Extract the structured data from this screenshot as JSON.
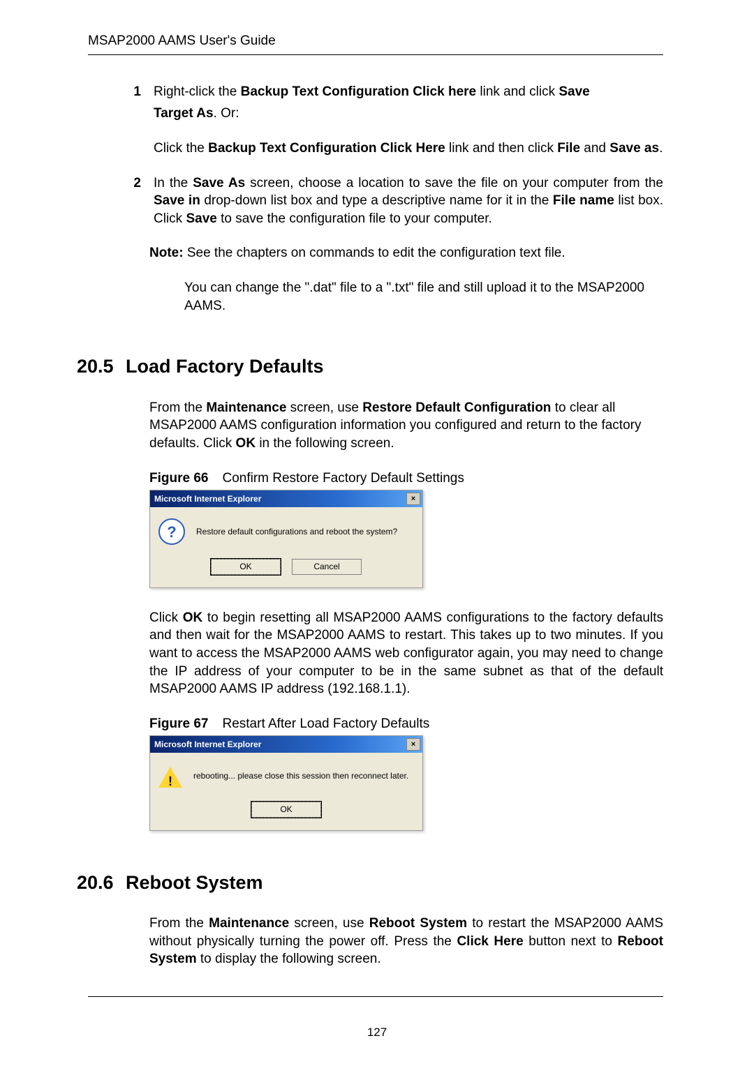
{
  "running_head": "MSAP2000 AAMS User's Guide",
  "page_number": "127",
  "step1": {
    "num": "1",
    "l1a": "Right-click the ",
    "b1": "Backup Text Configuration Click here",
    "l1b": " link and click ",
    "b2": "Save",
    "l2_bold": "Target As",
    "l2_tail": ". Or:",
    "l3a": "Click the ",
    "b3": "Backup Text Configuration Click Here",
    "l3b": " link and then click ",
    "b4": "File",
    "l3c": " and ",
    "b5": "Save as",
    "l3d": "."
  },
  "step2": {
    "num": "2",
    "a": "In the ",
    "b1": "Save As",
    "b": " screen, choose a location to save the file on your computer from the ",
    "b2": "Save in",
    "c": " drop-down list box and type a descriptive name for it in the ",
    "b3": "File name",
    "d": " list box. Click ",
    "b4": "Save",
    "e": " to save the configuration file to your computer."
  },
  "note": {
    "b": "Note:",
    "t": " See the chapters on commands to edit the configuration text file.",
    "body": "You can change the \".dat\" file to a \".txt\" file and still upload it to the MSAP2000 AAMS."
  },
  "sec205": {
    "no": "20.5",
    "title": "Load Factory Defaults",
    "intro_a": "From the ",
    "b1": "Maintenance",
    "intro_b": " screen, use ",
    "b2": "Restore Default Configuration",
    "intro_c": " to clear all MSAP2000 AAMS configuration information you configured and return to the factory defaults. Click ",
    "b3": "OK",
    "intro_d": " in the following screen."
  },
  "fig66": {
    "label": "Figure 66",
    "caption": "Confirm Restore Factory Default Settings",
    "title": "Microsoft Internet Explorer",
    "icon_char": "?",
    "msg": "Restore default configurations and reboot the system?",
    "ok": "OK",
    "cancel": "Cancel",
    "x": "×"
  },
  "after66": {
    "a": "Click ",
    "b1": "OK",
    "b": " to begin resetting all MSAP2000 AAMS configurations to the factory defaults and then wait for the MSAP2000 AAMS to restart. This takes up to two minutes. If you want to access the MSAP2000 AAMS web configurator again, you may need to change the IP address of your computer to be in the same subnet as that of the default MSAP2000 AAMS IP address (192.168.1.1)."
  },
  "fig67": {
    "label": "Figure 67",
    "caption": "Restart After Load Factory Defaults",
    "title": "Microsoft Internet Explorer",
    "icon_char": "!",
    "msg": "rebooting... please close this session then reconnect later.",
    "ok": "OK",
    "x": "×"
  },
  "sec206": {
    "no": "20.6",
    "title": "Reboot System",
    "intro_a": "From the ",
    "b1": "Maintenance",
    "intro_b": " screen, use ",
    "b2": "Reboot System",
    "intro_c": " to restart the MSAP2000 AAMS without physically turning the power off.   Press the ",
    "b3": "Click Here",
    "intro_d": " button next to ",
    "b4": "Reboot System",
    "intro_e": " to display the following screen."
  }
}
